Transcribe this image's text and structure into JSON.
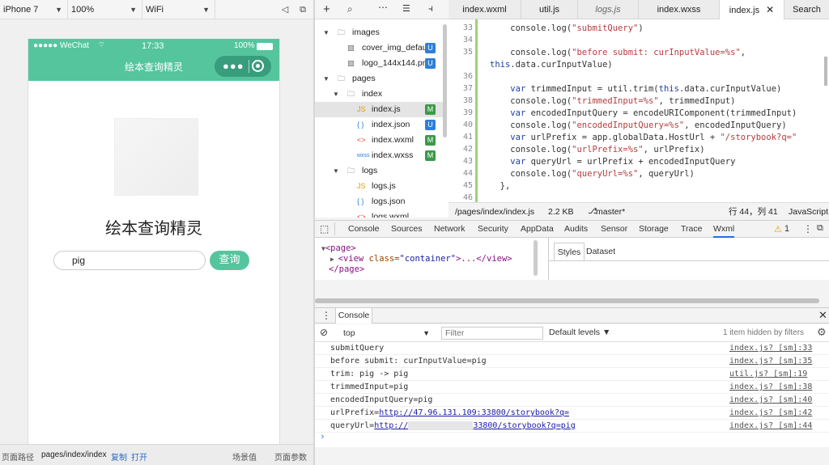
{
  "simulator": {
    "device": "iPhone 7",
    "zoom": "100%",
    "network": "WiFi",
    "status_carrier": "●●●●● WeChat",
    "status_time": "17:33",
    "status_battery": "100%",
    "nav_title": "绘本查询精灵",
    "page_heading": "绘本查询精灵",
    "search_value": "pig",
    "search_button": "查询"
  },
  "footer": {
    "path_label": "页面路径",
    "path_value": "pages/index/index",
    "copy_label": "复制",
    "open_label": "打开",
    "scene_label": "场景值",
    "params_label": "页面参数"
  },
  "file_tree": [
    {
      "label": "images",
      "icon": "folder-icon",
      "depth": 0,
      "arrow": "▼",
      "badge": ""
    },
    {
      "label": "cover_img_defaul...",
      "icon": "image-file-icon",
      "depth": 1,
      "arrow": "",
      "badge": "U"
    },
    {
      "label": "logo_144x144.png",
      "icon": "image-file-icon",
      "depth": 1,
      "arrow": "",
      "badge": "U"
    },
    {
      "label": "pages",
      "icon": "folder-icon",
      "depth": 0,
      "arrow": "▼",
      "badge": ""
    },
    {
      "label": "index",
      "icon": "folder-icon",
      "depth": 1,
      "arrow": "▼",
      "badge": ""
    },
    {
      "label": "index.js",
      "icon": "js-file-icon",
      "depth": 2,
      "arrow": "",
      "badge": "M"
    },
    {
      "label": "index.json",
      "icon": "json-file-icon",
      "depth": 2,
      "arrow": "",
      "badge": "U"
    },
    {
      "label": "index.wxml",
      "icon": "wxml-file-icon",
      "depth": 2,
      "arrow": "",
      "badge": "M"
    },
    {
      "label": "index.wxss",
      "icon": "wxss-file-icon",
      "depth": 2,
      "arrow": "",
      "badge": "M"
    },
    {
      "label": "logs",
      "icon": "folder-icon",
      "depth": 1,
      "arrow": "▼",
      "badge": ""
    },
    {
      "label": "logs.js",
      "icon": "js-file-icon",
      "depth": 2,
      "arrow": "",
      "badge": ""
    },
    {
      "label": "logs.json",
      "icon": "json-file-icon",
      "depth": 2,
      "arrow": "",
      "badge": ""
    },
    {
      "label": "logs.wxml",
      "icon": "wxml-file-icon",
      "depth": 2,
      "arrow": "",
      "badge": ""
    }
  ],
  "editor_tabs": [
    "index.wxml",
    "util.js",
    "logs.js",
    "index.wxss",
    "index.js",
    "Search"
  ],
  "code_lines": [
    {
      "n": "33",
      "text": "    console.log(\"submitQuery\")"
    },
    {
      "n": "34",
      "text": ""
    },
    {
      "n": "35",
      "text": "    console.log(\"before submit: curInputValue=%s\","
    },
    {
      "n": "",
      "text": "this.data.curInputValue)"
    },
    {
      "n": "36",
      "text": ""
    },
    {
      "n": "37",
      "text": "    var trimmedInput = util.trim(this.data.curInputValue)"
    },
    {
      "n": "38",
      "text": "    console.log(\"trimmedInput=%s\", trimmedInput)"
    },
    {
      "n": "39",
      "text": "    var encodedInputQuery = encodeURIComponent(trimmedInput)"
    },
    {
      "n": "40",
      "text": "    console.log(\"encodedInputQuery=%s\", encodedInputQuery)"
    },
    {
      "n": "41",
      "text": "    var urlPrefix = app.globalData.HostUrl + \"/storybook?q=\""
    },
    {
      "n": "42",
      "text": "    console.log(\"urlPrefix=%s\", urlPrefix)"
    },
    {
      "n": "43",
      "text": "    var queryUrl = urlPrefix + encodedInputQuery"
    },
    {
      "n": "44",
      "text": "    console.log(\"queryUrl=%s\", queryUrl)"
    },
    {
      "n": "45",
      "text": "  },"
    },
    {
      "n": "46",
      "text": ""
    }
  ],
  "status_bar": {
    "path": "/pages/index/index.js",
    "size": "2.2 KB",
    "branch": "master*",
    "position": "行 44，列 41",
    "language": "JavaScript"
  },
  "devtools_tabs": [
    "Console",
    "Sources",
    "Network",
    "Security",
    "AppData",
    "Audits",
    "Sensor",
    "Storage",
    "Trace",
    "Wxml"
  ],
  "devtools_warnings": "1",
  "elements": {
    "line1": "<page>",
    "line2_tag": "<view ",
    "line2_attr": "class=",
    "line2_val": "\"container\"",
    "line2_rest": ">...</view>",
    "line3": "</page>"
  },
  "styles_tabs": [
    "Styles",
    "Dataset"
  ],
  "drawer_tab": "Console",
  "console_toolbar": {
    "context": "top",
    "filter_placeholder": "Filter",
    "levels": "Default levels ▼",
    "hidden": "1 item hidden by filters"
  },
  "console_lines": [
    {
      "msg": "submitQuery",
      "src": "index.js? [sm]:33"
    },
    {
      "msg": "before submit: curInputValue=pig",
      "src": "index.js? [sm]:35"
    },
    {
      "msg": "trim: pig -> pig",
      "src": "util.js? [sm]:19"
    },
    {
      "msg": "trimmedInput=pig",
      "src": "index.js? [sm]:38"
    },
    {
      "msg": "encodedInputQuery=pig",
      "src": "index.js? [sm]:40"
    },
    {
      "msg_prefix": "urlPrefix=",
      "link": "http://47.96.131.109:33800/storybook?q=",
      "src": "index.js? [sm]:42"
    },
    {
      "msg_prefix": "queryUrl=",
      "link": "http://",
      "link_tail": "33800/storybook?q=pig",
      "src": "index.js? [sm]:44"
    }
  ],
  "colors": {
    "wechat_green": "#55c59e",
    "badge_untracked": "#2f7fd8",
    "badge_modified": "#3a9a48"
  }
}
